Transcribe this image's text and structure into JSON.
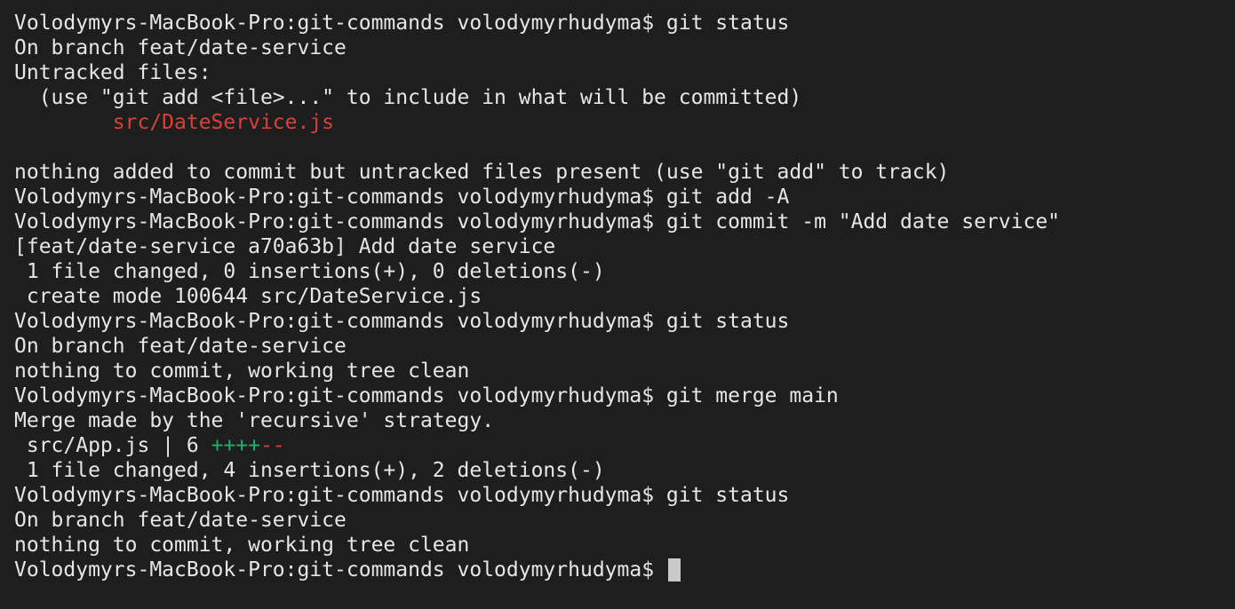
{
  "colors": {
    "background": "#1e1e1e",
    "text": "#e6e6e6",
    "untracked_file": "#d8413a",
    "insertions": "#20b36b",
    "deletions": "#d8413a",
    "cursor": "#c9c9c9"
  },
  "terminal": {
    "lines": [
      [
        {
          "t": "Volodymyrs-MacBook-Pro:git-commands volodymyrhudyma$ git status"
        }
      ],
      [
        {
          "t": "On branch feat/date-service"
        }
      ],
      [
        {
          "t": "Untracked files:"
        }
      ],
      [
        {
          "t": "  (use \"git add <file>...\" to include in what will be committed)"
        }
      ],
      [
        {
          "t": "        "
        },
        {
          "t": "src/DateService.js",
          "c": "red"
        }
      ],
      [
        {
          "t": ""
        }
      ],
      [
        {
          "t": "nothing added to commit but untracked files present (use \"git add\" to track)"
        }
      ],
      [
        {
          "t": "Volodymyrs-MacBook-Pro:git-commands volodymyrhudyma$ git add -A"
        }
      ],
      [
        {
          "t": "Volodymyrs-MacBook-Pro:git-commands volodymyrhudyma$ git commit -m \"Add date service\""
        }
      ],
      [
        {
          "t": "[feat/date-service a70a63b] Add date service"
        }
      ],
      [
        {
          "t": " 1 file changed, 0 insertions(+), 0 deletions(-)"
        }
      ],
      [
        {
          "t": " create mode 100644 src/DateService.js"
        }
      ],
      [
        {
          "t": "Volodymyrs-MacBook-Pro:git-commands volodymyrhudyma$ git status"
        }
      ],
      [
        {
          "t": "On branch feat/date-service"
        }
      ],
      [
        {
          "t": "nothing to commit, working tree clean"
        }
      ],
      [
        {
          "t": "Volodymyrs-MacBook-Pro:git-commands volodymyrhudyma$ git merge main"
        }
      ],
      [
        {
          "t": "Merge made by the 'recursive' strategy."
        }
      ],
      [
        {
          "t": " src/App.js | 6 "
        },
        {
          "t": "++++",
          "c": "green"
        },
        {
          "t": "--",
          "c": "red"
        }
      ],
      [
        {
          "t": " 1 file changed, 4 insertions(+), 2 deletions(-)"
        }
      ],
      [
        {
          "t": "Volodymyrs-MacBook-Pro:git-commands volodymyrhudyma$ git status"
        }
      ],
      [
        {
          "t": "On branch feat/date-service"
        }
      ],
      [
        {
          "t": "nothing to commit, working tree clean"
        }
      ],
      [
        {
          "t": "Volodymyrs-MacBook-Pro:git-commands volodymyrhudyma$ ",
          "cursor": true
        }
      ]
    ]
  }
}
